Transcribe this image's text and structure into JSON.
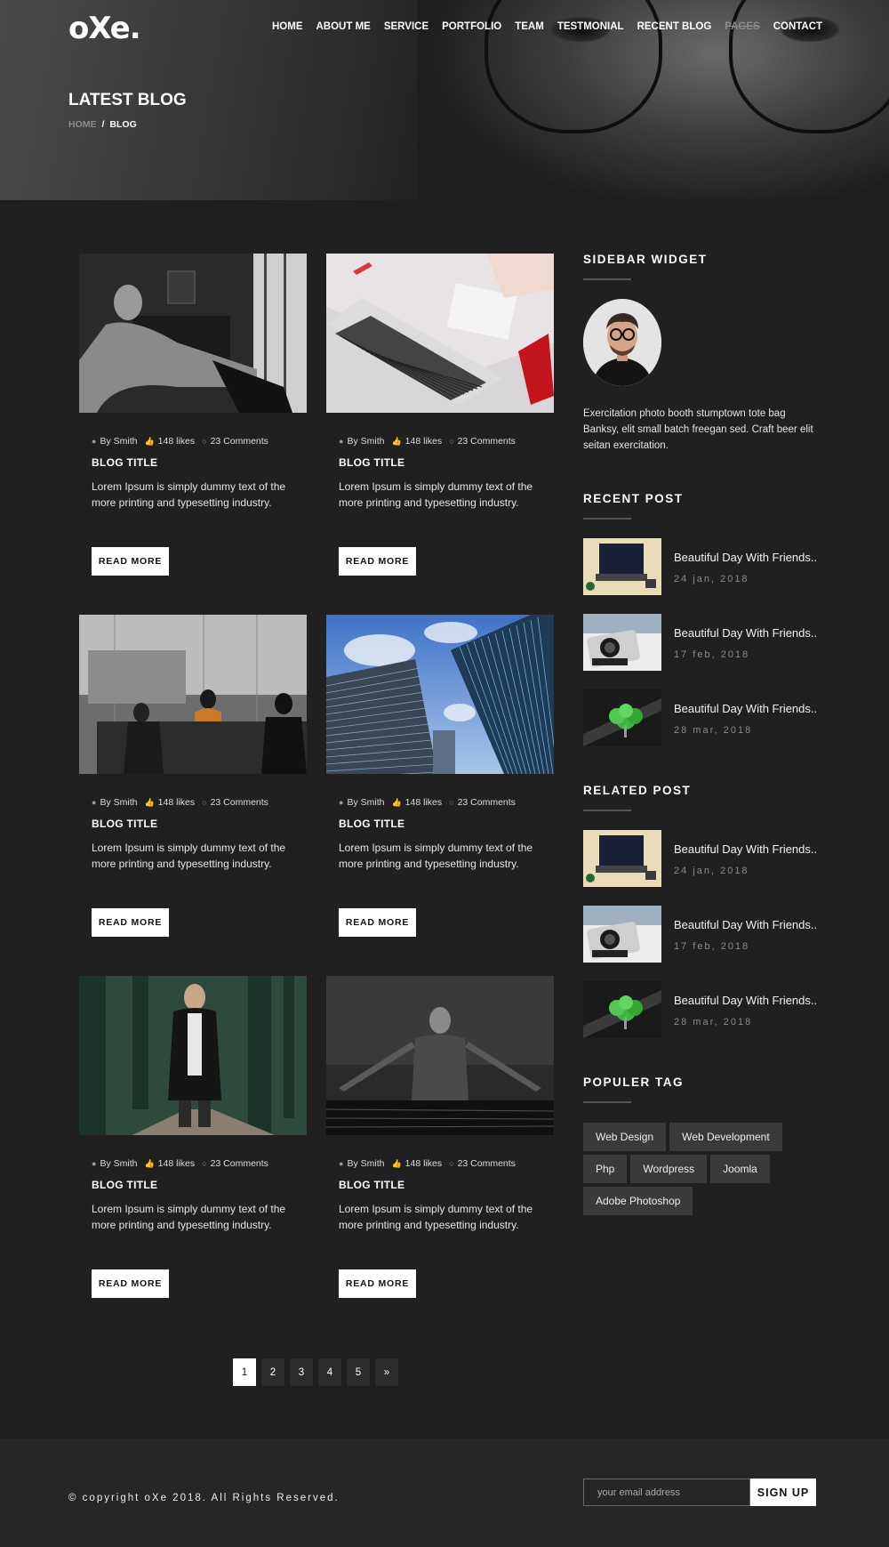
{
  "brand": {
    "logo": "oXe."
  },
  "nav": [
    "HOME",
    "ABOUT ME",
    "SERVICE",
    "PORTFOLIO",
    "TEAM",
    "TESTMONIAL",
    "RECENT BLOG",
    "PAGES",
    "CONTACT"
  ],
  "hero": {
    "title": "LATEST BLOG",
    "crumb_home": "HOME",
    "crumb_sep": "/",
    "crumb_current": "BLOG"
  },
  "posts": [
    {
      "author": "By Smith",
      "likes": "148 likes",
      "comments": "23 Comments",
      "title": "BLOG TITLE",
      "excerpt": "Lorem Ipsum is simply dummy text of the more printing and typesetting industry.",
      "button": "READ MORE",
      "image": "man-sitting-by-window"
    },
    {
      "author": "By Smith",
      "likes": "148 likes",
      "comments": "23 Comments",
      "title": "BLOG TITLE",
      "excerpt": "Lorem Ipsum is simply dummy text of the more printing and typesetting industry.",
      "button": "READ MORE",
      "image": "laptop-on-desk"
    },
    {
      "author": "By Smith",
      "likes": "148 likes",
      "comments": "23 Comments",
      "title": "BLOG TITLE",
      "excerpt": "Lorem Ipsum is simply dummy text of the more printing and typesetting industry.",
      "button": "READ MORE",
      "image": "meeting-room"
    },
    {
      "author": "By Smith",
      "likes": "148 likes",
      "comments": "23 Comments",
      "title": "BLOG TITLE",
      "excerpt": "Lorem Ipsum is simply dummy text of the more printing and typesetting industry.",
      "button": "READ MORE",
      "image": "skyscrapers"
    },
    {
      "author": "By Smith",
      "likes": "148 likes",
      "comments": "23 Comments",
      "title": "BLOG TITLE",
      "excerpt": "Lorem Ipsum is simply dummy text of the more printing and typesetting industry.",
      "button": "READ MORE",
      "image": "man-in-leather-jacket"
    },
    {
      "author": "By Smith",
      "likes": "148 likes",
      "comments": "23 Comments",
      "title": "BLOG TITLE",
      "excerpt": "Lorem Ipsum is simply dummy text of the more printing and typesetting industry.",
      "button": "READ MORE",
      "image": "man-in-water"
    }
  ],
  "pagination": {
    "pages": [
      "1",
      "2",
      "3",
      "4",
      "5"
    ],
    "next": "»",
    "active": "1"
  },
  "sidebar": {
    "widget_title": "SIDEBAR WIDGET",
    "bio": "Exercitation photo booth stumptown tote bag Banksy, elit small batch freegan sed. Craft beer elit seitan exercitation.",
    "recent_title": "RECENT POST",
    "recent": [
      {
        "title": "Beautiful Day With Friends..",
        "date": "24 jan, 2018"
      },
      {
        "title": "Beautiful Day With Friends..",
        "date": "17 feb, 2018"
      },
      {
        "title": "Beautiful Day With Friends..",
        "date": "28 mar, 2018"
      }
    ],
    "related_title": "RELATED POST",
    "related": [
      {
        "title": "Beautiful Day With Friends..",
        "date": "24 jan, 2018"
      },
      {
        "title": "Beautiful Day With Friends..",
        "date": "17 feb, 2018"
      },
      {
        "title": "Beautiful Day With Friends..",
        "date": "28 mar, 2018"
      }
    ],
    "tags_title": "POPULER TAG",
    "tags": [
      "Web Design",
      "Web Development",
      "Php",
      "Wordpress",
      "Joomla",
      "Adobe Photoshop"
    ]
  },
  "footer": {
    "copyright": "© copyright oXe 2018. All Rights Reserved.",
    "email_placeholder": "your email address",
    "signup": "SIGN UP"
  },
  "colors": {
    "background": "#202020",
    "footer": "#262626",
    "tag": "#3a3a3a",
    "accent": "#ffffff"
  }
}
